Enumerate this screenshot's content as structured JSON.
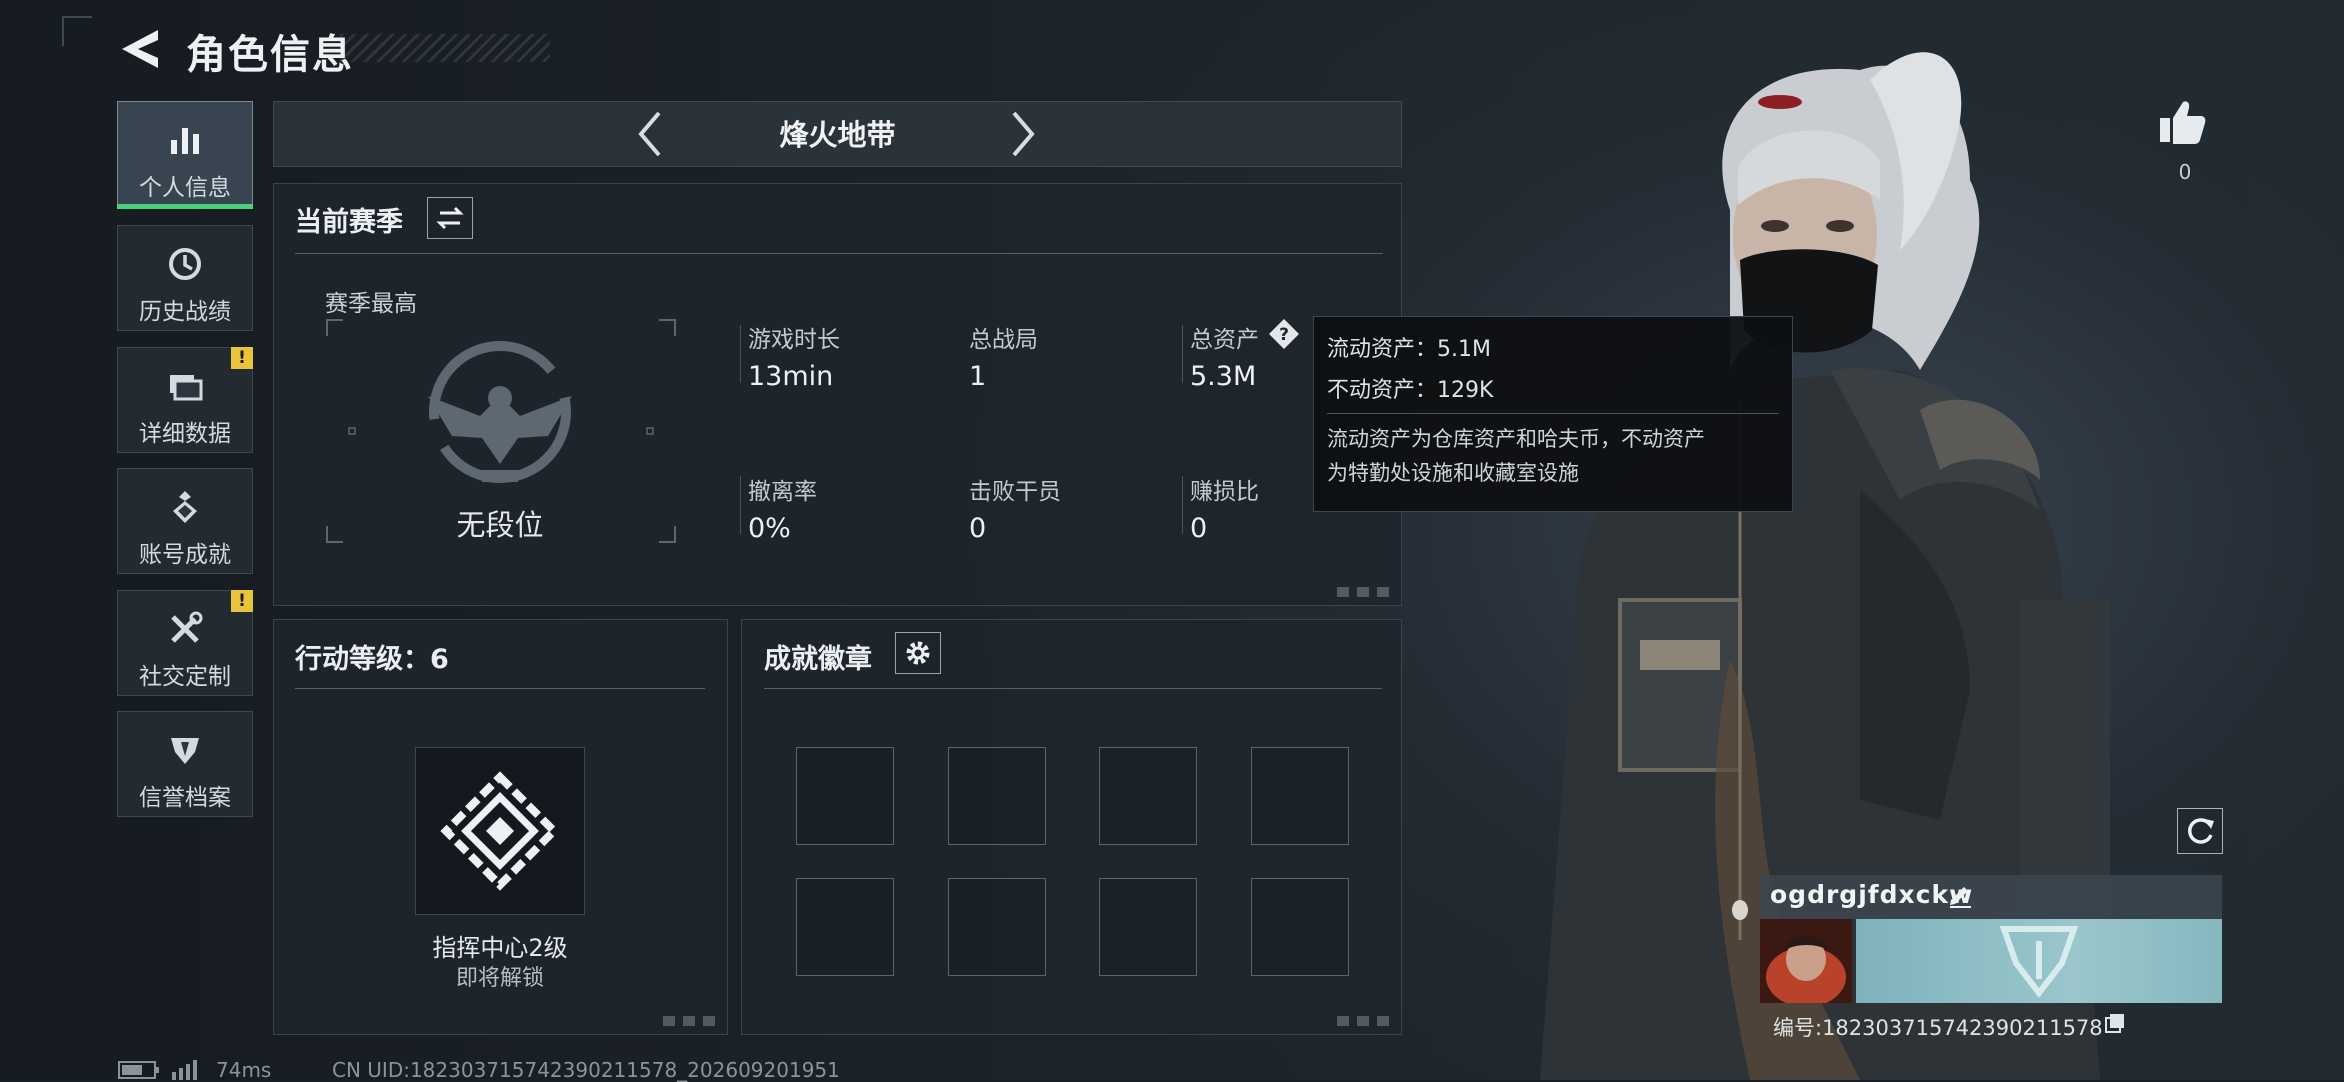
{
  "header": {
    "title": "角色信息"
  },
  "sidebar": {
    "items": [
      {
        "label": "个人信息",
        "active": true,
        "warning": ""
      },
      {
        "label": "历史战绩",
        "active": false,
        "warning": ""
      },
      {
        "label": "详细数据",
        "active": false,
        "warning": "!"
      },
      {
        "label": "账号成就",
        "active": false,
        "warning": ""
      },
      {
        "label": "社交定制",
        "active": false,
        "warning": "!"
      },
      {
        "label": "信誉档案",
        "active": false,
        "warning": ""
      }
    ]
  },
  "mode": {
    "title": "烽火地带"
  },
  "season": {
    "title": "当前赛季",
    "best_label": "赛季最高",
    "rank": "无段位",
    "stats": [
      {
        "label": "游戏时长",
        "value": "13min"
      },
      {
        "label": "总战局",
        "value": "1"
      },
      {
        "label": "总资产",
        "value": "5.3M"
      },
      {
        "label": "撤离率",
        "value": "0%"
      },
      {
        "label": "击败干员",
        "value": "0"
      },
      {
        "label": "赚损比",
        "value": "0"
      }
    ]
  },
  "tooltip": {
    "liquid": "流动资产：5.1M",
    "fixed": "不动资产：129K",
    "note_line1": "流动资产为仓库资产和哈夫币，不动资产",
    "note_line2": "为特勤处设施和收藏室设施"
  },
  "action_level": {
    "title": "行动等级：6",
    "unlock_name": "指挥中心2级",
    "unlock_status": "即将解锁"
  },
  "badges": {
    "title": "成就徽章"
  },
  "likes": {
    "count": "0"
  },
  "profile": {
    "name": "ogdrgjfdxckw",
    "id_text": "编号:18230371574239021157​8"
  },
  "footer": {
    "ping": "74ms",
    "uid": "CN UID:18230371574239021157​8_202609201951"
  },
  "colors": {
    "accent": "#48d27e",
    "warning": "#e9c43a"
  }
}
